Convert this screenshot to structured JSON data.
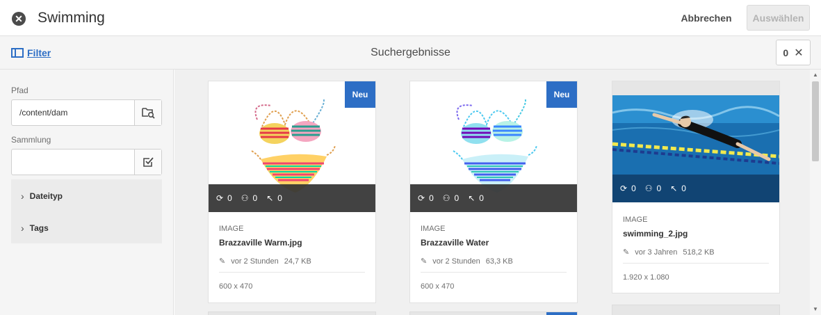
{
  "header": {
    "title": "Swimming",
    "cancel_label": "Abbrechen",
    "select_label": "Auswählen"
  },
  "subbar": {
    "filter_label": "Filter",
    "title": "Suchergebnisse",
    "selected_count": "0"
  },
  "sidebar": {
    "path_label": "Pfad",
    "path_value": "/content/dam",
    "collection_label": "Sammlung",
    "collection_value": "",
    "accordion": [
      {
        "label": "Dateityp"
      },
      {
        "label": "Tags"
      }
    ]
  },
  "cards": [
    {
      "badge": "Neu",
      "stats": [
        "0",
        "0",
        "0"
      ],
      "type": "IMAGE",
      "name": "Brazzaville Warm.jpg",
      "modified": "vor 2 Stunden",
      "size": "24,7 KB",
      "dimensions": "600 x 470"
    },
    {
      "badge": "Neu",
      "stats": [
        "0",
        "0",
        "0"
      ],
      "type": "IMAGE",
      "name": "Brazzaville Water",
      "modified": "vor 2 Stunden",
      "size": "63,3 KB",
      "dimensions": "600 x 470"
    },
    {
      "badge": "",
      "stats": [
        "0",
        "0",
        "0"
      ],
      "type": "IMAGE",
      "name": "swimming_2.jpg",
      "modified": "vor 3 Jahren",
      "size": "518,2 KB",
      "dimensions": "1.920 x 1.080"
    }
  ],
  "colors": {
    "accent": "#2d6ec5",
    "overlay": "#323232",
    "sidebar_bg": "#f5f5f5"
  }
}
